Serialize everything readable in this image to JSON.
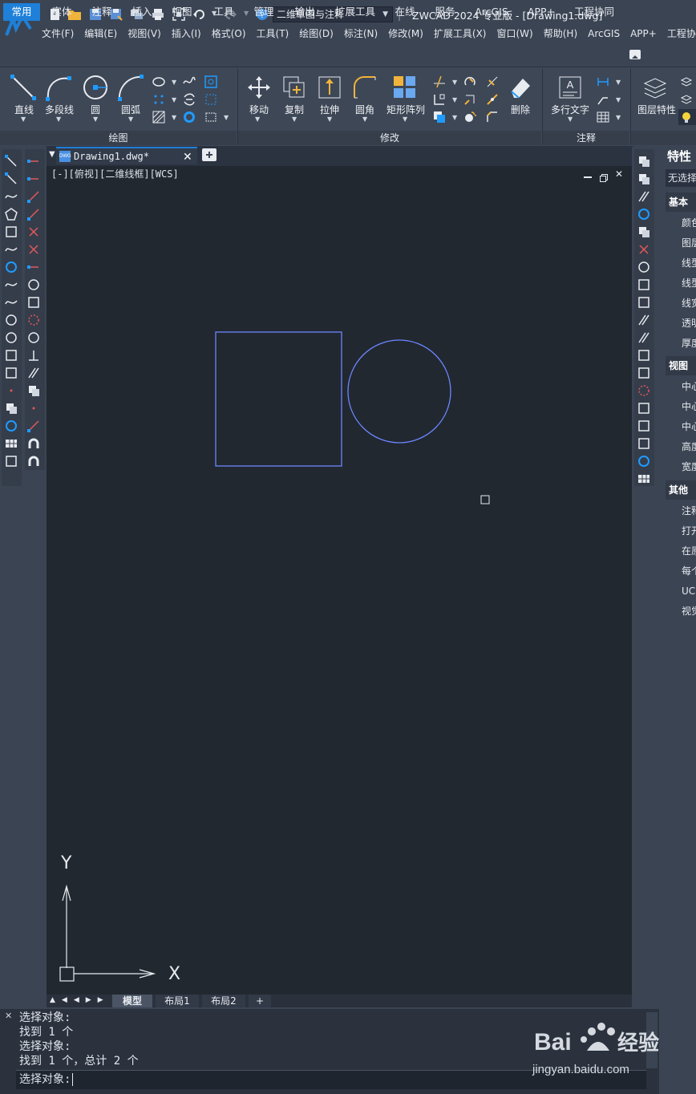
{
  "quick_access": {
    "workspace": "二维草图与注释"
  },
  "title": "ZWCAD 2024 专业版 - [Drawing1.dwg]",
  "menu": [
    "文件(F)",
    "编辑(E)",
    "视图(V)",
    "插入(I)",
    "格式(O)",
    "工具(T)",
    "绘图(D)",
    "标注(N)",
    "修改(M)",
    "扩展工具(X)",
    "窗口(W)",
    "帮助(H)",
    "ArcGIS",
    "APP+",
    "工程协"
  ],
  "ribbon_tabs": [
    "常用",
    "实体",
    "注释",
    "插入",
    "视图",
    "工具",
    "管理",
    "输出",
    "扩展工具",
    "在线",
    "服务",
    "ArcGIS",
    "APP+",
    "工程协同"
  ],
  "ribbon": {
    "draw": {
      "group_label": "绘图",
      "line": "直线",
      "polyline": "多段线",
      "circle": "圆",
      "arc": "圆弧"
    },
    "modify": {
      "group_label": "修改",
      "move": "移动",
      "copy": "复制",
      "stretch": "拉伸",
      "fillet": "圆角",
      "array": "矩形阵列",
      "delete": "删除"
    },
    "annotate": {
      "group_label": "注释",
      "mtext": "多行文字"
    },
    "layers": {
      "layer_props": "图层特性"
    }
  },
  "document": {
    "tab": "Drawing1.dwg*",
    "view_label": "[-][俯视][二维线框][WCS]"
  },
  "layout_tabs": [
    "模型",
    "布局1",
    "布局2",
    "+"
  ],
  "ucs": {
    "x": "X",
    "y": "Y"
  },
  "command": {
    "history": [
      "选择对象:",
      "找到 1 个",
      "选择对象:",
      "找到 1 个，总计 2 个"
    ],
    "prompt": "选择对象:"
  },
  "properties": {
    "title": "特性",
    "selection": "无选择",
    "sections": {
      "basic": {
        "label": "基本",
        "rows": [
          "颜色",
          "图层",
          "线型",
          "线型",
          "线宽",
          "透明",
          "厚度"
        ]
      },
      "view": {
        "label": "视图",
        "rows": [
          "中心",
          "中心",
          "中心",
          "高度",
          "宽度"
        ]
      },
      "misc": {
        "label": "其他",
        "rows": [
          "注释",
          "打开",
          "在原",
          "每个",
          "UC",
          "视觉"
        ]
      }
    }
  },
  "watermark": {
    "brand": "Bai经验",
    "url": "jingyan.baidu.com"
  },
  "colors": {
    "accent": "#1e80d8",
    "canvas": "#212830",
    "entity": "#6c86ff"
  }
}
